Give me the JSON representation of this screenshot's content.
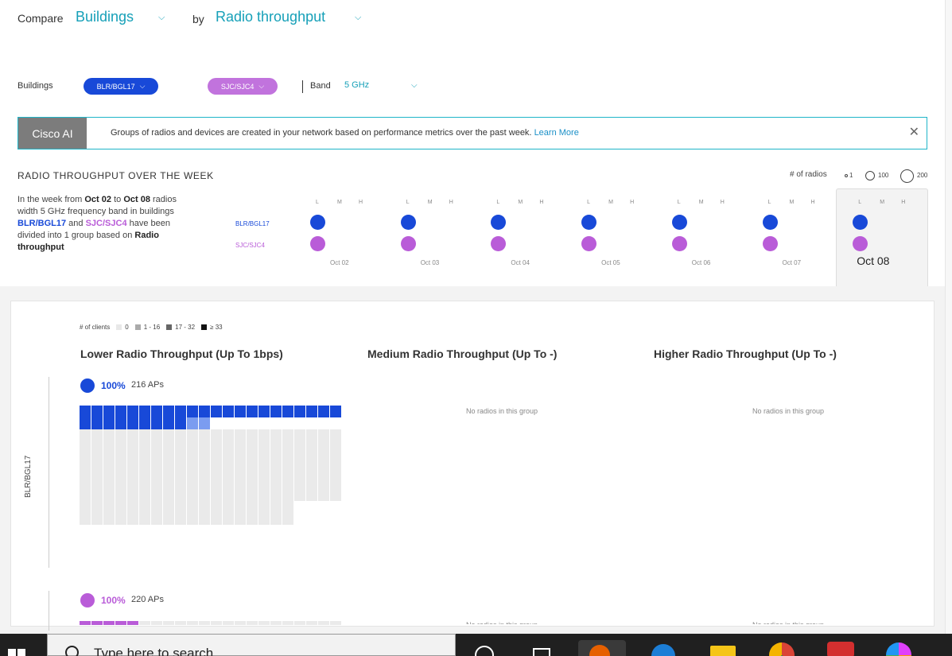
{
  "compare": {
    "label": "Compare",
    "entity": "Buildings",
    "by_label": "by",
    "metric": "Radio throughput"
  },
  "filters": {
    "buildings_label": "Buildings",
    "building_1": "BLR/BGL17",
    "building_2": "SJC/SJC4",
    "band_label": "Band",
    "band_value": "5 GHz"
  },
  "banner": {
    "tag": "Cisco AI",
    "message": "Groups of radios and devices are created in your network based on performance metrics over the past week.",
    "link": "Learn More"
  },
  "weekly": {
    "title": "RADIO THROUGHPUT OVER THE WEEK",
    "radios_legend_label": "# of radios",
    "radios_legend": [
      "1",
      "100",
      "200"
    ],
    "desc_parts": [
      "In the week from ",
      "Oct 02",
      " to ",
      "Oct 08",
      " radios width 5 GHz frequency band in buildings ",
      "BLR/BGL17",
      " and ",
      "SJC/SJC4",
      " have been divided into 1 group based on ",
      "Radio throughput"
    ],
    "row_labels": [
      "BLR/BGL17",
      "SJC/SJC4"
    ],
    "lmh": [
      "L",
      "M",
      "H"
    ],
    "days": [
      "Oct 02",
      "Oct 03",
      "Oct 04",
      "Oct 05",
      "Oct 06",
      "Oct 07",
      "Oct 08"
    ],
    "selected_day": "Oct 08"
  },
  "clients_legend": {
    "label": "# of clients",
    "items": [
      {
        "label": "0",
        "color": "#e8e8e8"
      },
      {
        "label": "1 - 16",
        "color": "#aaaaaa"
      },
      {
        "label": "17 - 32",
        "color": "#666666"
      },
      {
        "label": "≥ 33",
        "color": "#111111"
      }
    ]
  },
  "groups": {
    "lower": "Lower Radio Throughput (Up To 1bps)",
    "medium": "Medium Radio Throughput (Up To -)",
    "higher": "Higher Radio Throughput (Up To -)",
    "no_radios": "No radios in this group"
  },
  "buildings": [
    {
      "name": "BLR/BGL17",
      "pct": "100%",
      "aps": "216 APs",
      "color": "#1849d8"
    },
    {
      "name": "SJC/SJC4",
      "pct": "100%",
      "aps": "220 APs",
      "color": "#b95cd8"
    }
  ],
  "taskbar": {
    "search_placeholder": "Type here to search"
  }
}
